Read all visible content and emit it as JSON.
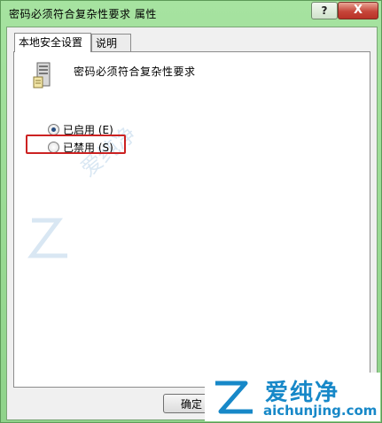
{
  "window": {
    "title": "密码必须符合复杂性要求 属性",
    "help_label": "?",
    "close_label": "X"
  },
  "tabs": [
    {
      "label": "本地安全设置",
      "active": true
    },
    {
      "label": "说明",
      "active": false
    }
  ],
  "policy": {
    "title": "密码必须符合复杂性要求",
    "icon": "server-policy-icon"
  },
  "options": [
    {
      "label": "已启用 (E)",
      "checked": true
    },
    {
      "label": "已禁用 (S)",
      "checked": false
    }
  ],
  "buttons": {
    "ok": "确定"
  },
  "watermark": {
    "brand": "爱纯净",
    "url": "aichunjing.com"
  },
  "colors": {
    "frame": "#a6e3a0",
    "highlight": "#cc2222",
    "watermark": "#1788c8"
  }
}
